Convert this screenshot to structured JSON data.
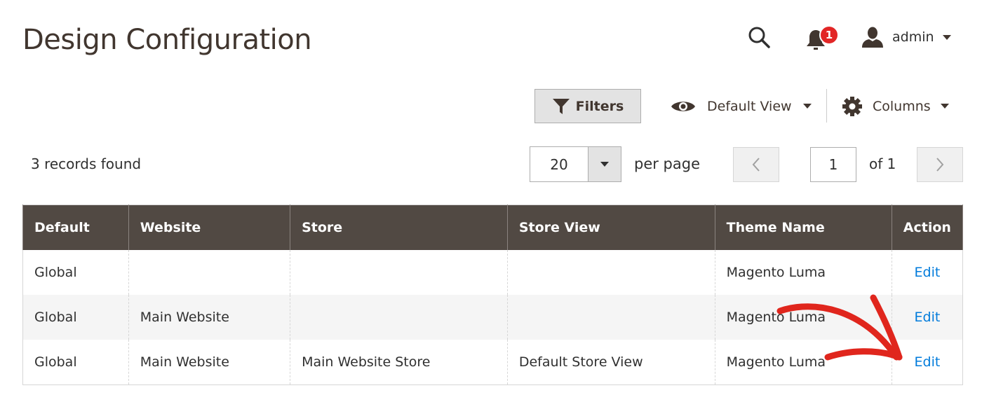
{
  "header": {
    "title": "Design Configuration",
    "notifications_count": "1",
    "user_name": "admin",
    "icons": {
      "search": "search-icon",
      "notifications": "bell-icon",
      "user": "user-icon"
    }
  },
  "toolbar": {
    "filters_label": "Filters",
    "view_label": "Default View",
    "columns_label": "Columns"
  },
  "listing": {
    "records_found": "3 records found",
    "per_page_value": "20",
    "per_page_label": "per page",
    "current_page": "1",
    "total_pages_label": "of 1"
  },
  "table": {
    "columns": [
      "Default",
      "Website",
      "Store",
      "Store View",
      "Theme Name",
      "Action"
    ],
    "rows": [
      {
        "default": "Global",
        "website": "",
        "store": "",
        "store_view": "",
        "theme": "Magento Luma",
        "action": "Edit"
      },
      {
        "default": "Global",
        "website": "Main Website",
        "store": "",
        "store_view": "",
        "theme": "Magento Luma",
        "action": "Edit"
      },
      {
        "default": "Global",
        "website": "Main Website",
        "store": "Main Website Store",
        "store_view": "Default Store View",
        "theme": "Magento Luma",
        "action": "Edit"
      }
    ]
  },
  "annotation": {
    "type": "red-arrow",
    "color": "#e0261d",
    "points_to": "Edit (row 3)"
  },
  "colors": {
    "header_bg": "#514943",
    "link": "#007bdb",
    "badge": "#e22626"
  }
}
